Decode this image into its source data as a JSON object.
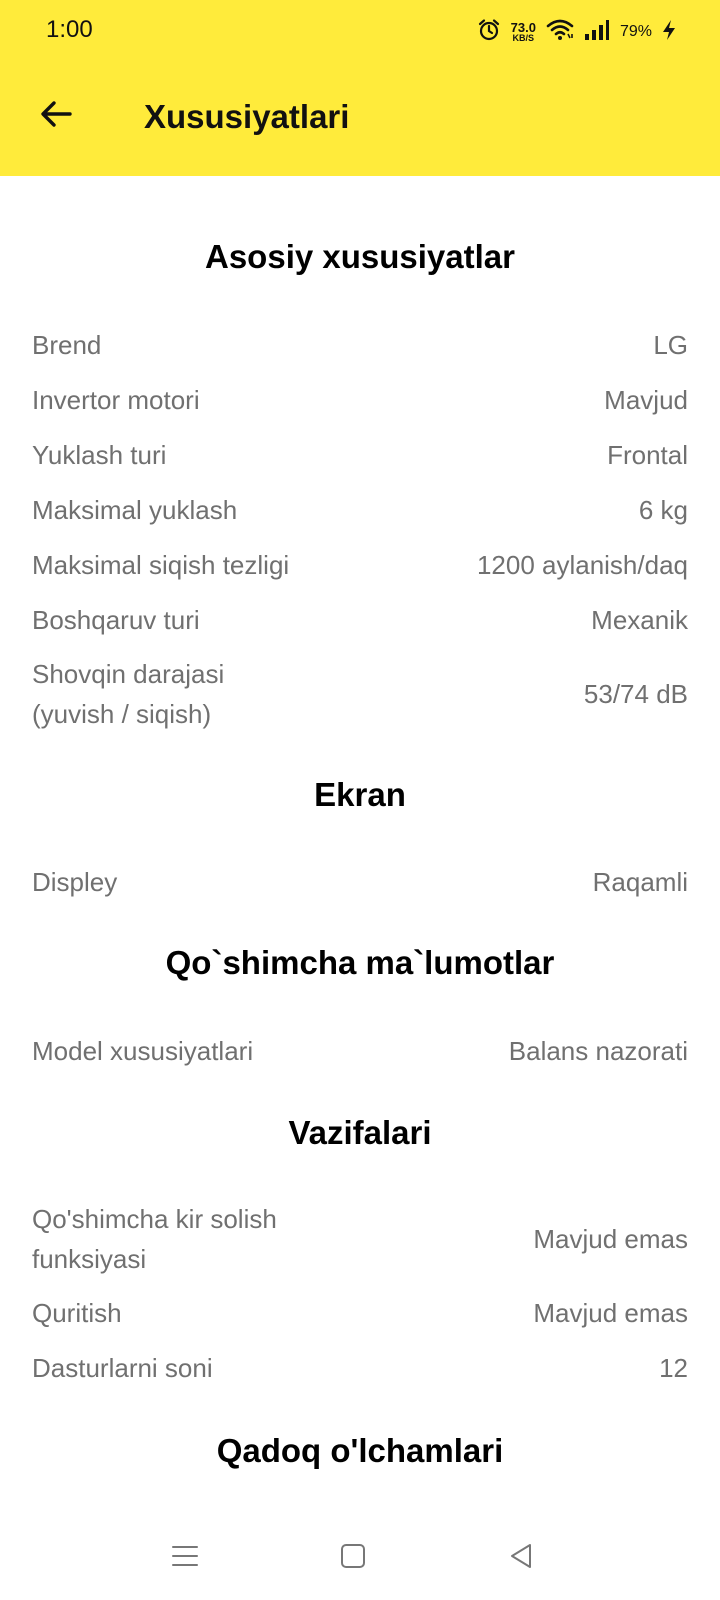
{
  "status": {
    "time": "1:00",
    "net_speed_value": "73.0",
    "net_speed_unit": "KB/S",
    "battery": "79%"
  },
  "appbar": {
    "title": "Xususiyatlari"
  },
  "sections": [
    {
      "title": "Asosiy xususiyatlar",
      "rows": [
        {
          "label": "Brend",
          "value": "LG"
        },
        {
          "label": "Invertor motori",
          "value": "Mavjud"
        },
        {
          "label": "Yuklash turi",
          "value": "Frontal"
        },
        {
          "label": "Maksimal yuklash",
          "value": "6 kg"
        },
        {
          "label": "Maksimal siqish tezligi",
          "value": "1200 aylanish/daq"
        },
        {
          "label": "Boshqaruv turi",
          "value": "Mexanik"
        },
        {
          "label": "Shovqin darajasi (yuvish / siqish)",
          "value": "53/74 dB"
        }
      ]
    },
    {
      "title": "Ekran",
      "rows": [
        {
          "label": "Displey",
          "value": "Raqamli"
        }
      ]
    },
    {
      "title": "Qo`shimcha ma`lumotlar",
      "rows": [
        {
          "label": "Model xususiyatlari",
          "value": "Balans nazorati"
        }
      ]
    },
    {
      "title": "Vazifalari",
      "rows": [
        {
          "label": "Qo'shimcha kir solish funksiyasi",
          "value": "Mavjud emas"
        },
        {
          "label": "Quritish",
          "value": "Mavjud emas"
        },
        {
          "label": "Dasturlarni soni",
          "value": "12"
        }
      ]
    },
    {
      "title": "Qadoq o'lchamlari",
      "rows": []
    }
  ],
  "icons": {
    "back": "arrow-left-icon",
    "alarm": "alarm-icon",
    "wifi": "wifi-icon",
    "signal": "signal-icon",
    "charging": "charging-icon",
    "nav_menu": "menu-icon",
    "nav_home": "home-icon",
    "nav_back": "back-triangle-icon"
  },
  "colors": {
    "accent": "#FFEB3B",
    "label_text": "#707070",
    "heading_text": "#000000"
  }
}
